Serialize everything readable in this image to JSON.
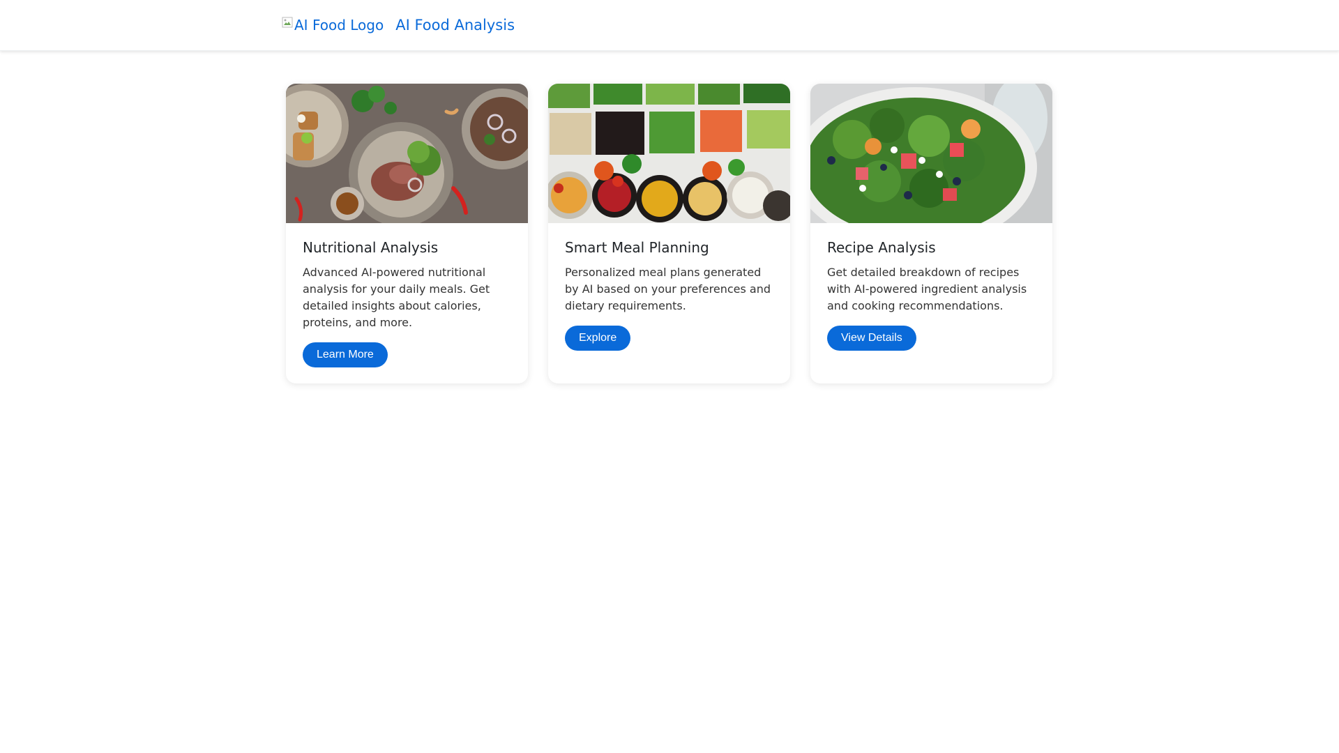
{
  "header": {
    "logo_alt": "AI Food Logo",
    "title": "AI Food Analysis"
  },
  "colors": {
    "accent": "#0a6ad9",
    "card_bg": "#ffffff",
    "text": "#212529"
  },
  "cards": [
    {
      "image_name": "plated-dishes-photo",
      "title": "Nutritional Analysis",
      "text": "Advanced AI-powered nutritional analysis for your daily meals. Get detailed insights about calories, proteins, and more.",
      "button": "Learn More"
    },
    {
      "image_name": "vegetable-bowls-photo",
      "title": "Smart Meal Planning",
      "text": "Personalized meal plans generated by AI based on your preferences and dietary requirements.",
      "button": "Explore"
    },
    {
      "image_name": "salad-bowl-photo",
      "title": "Recipe Analysis",
      "text": "Get detailed breakdown of recipes with AI-powered ingredient analysis and cooking recommendations.",
      "button": "View Details"
    }
  ]
}
